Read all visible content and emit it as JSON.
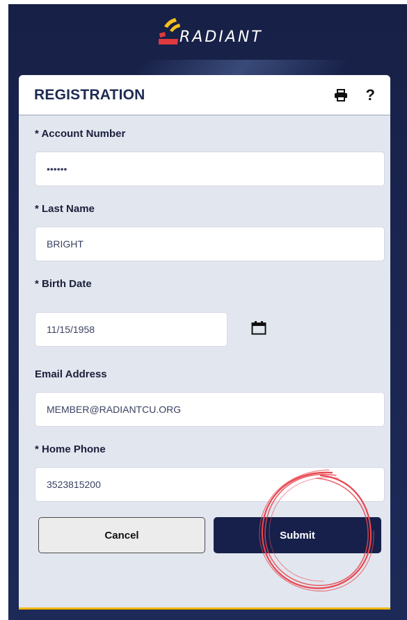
{
  "header": {
    "logo_text": "RADIANT"
  },
  "card": {
    "title": "REGISTRATION"
  },
  "form": {
    "account_number": {
      "label": "* Account Number",
      "value": "••••••"
    },
    "last_name": {
      "label": "* Last Name",
      "value": "BRIGHT"
    },
    "birth_date": {
      "label": "* Birth Date",
      "value": "11/15/1958"
    },
    "email": {
      "label": "Email Address",
      "value": "MEMBER@RADIANTCU.ORG"
    },
    "home_phone": {
      "label": "* Home Phone",
      "value": "3523815200"
    }
  },
  "actions": {
    "cancel_label": "Cancel",
    "submit_label": "Submit"
  },
  "colors": {
    "navy": "#172046",
    "accent": "#f2b705",
    "logo_red": "#e03a3e",
    "logo_yellow": "#f6c21c",
    "highlight": "#e8454f"
  },
  "icons": [
    "print-icon",
    "help-icon",
    "calendar-icon"
  ]
}
